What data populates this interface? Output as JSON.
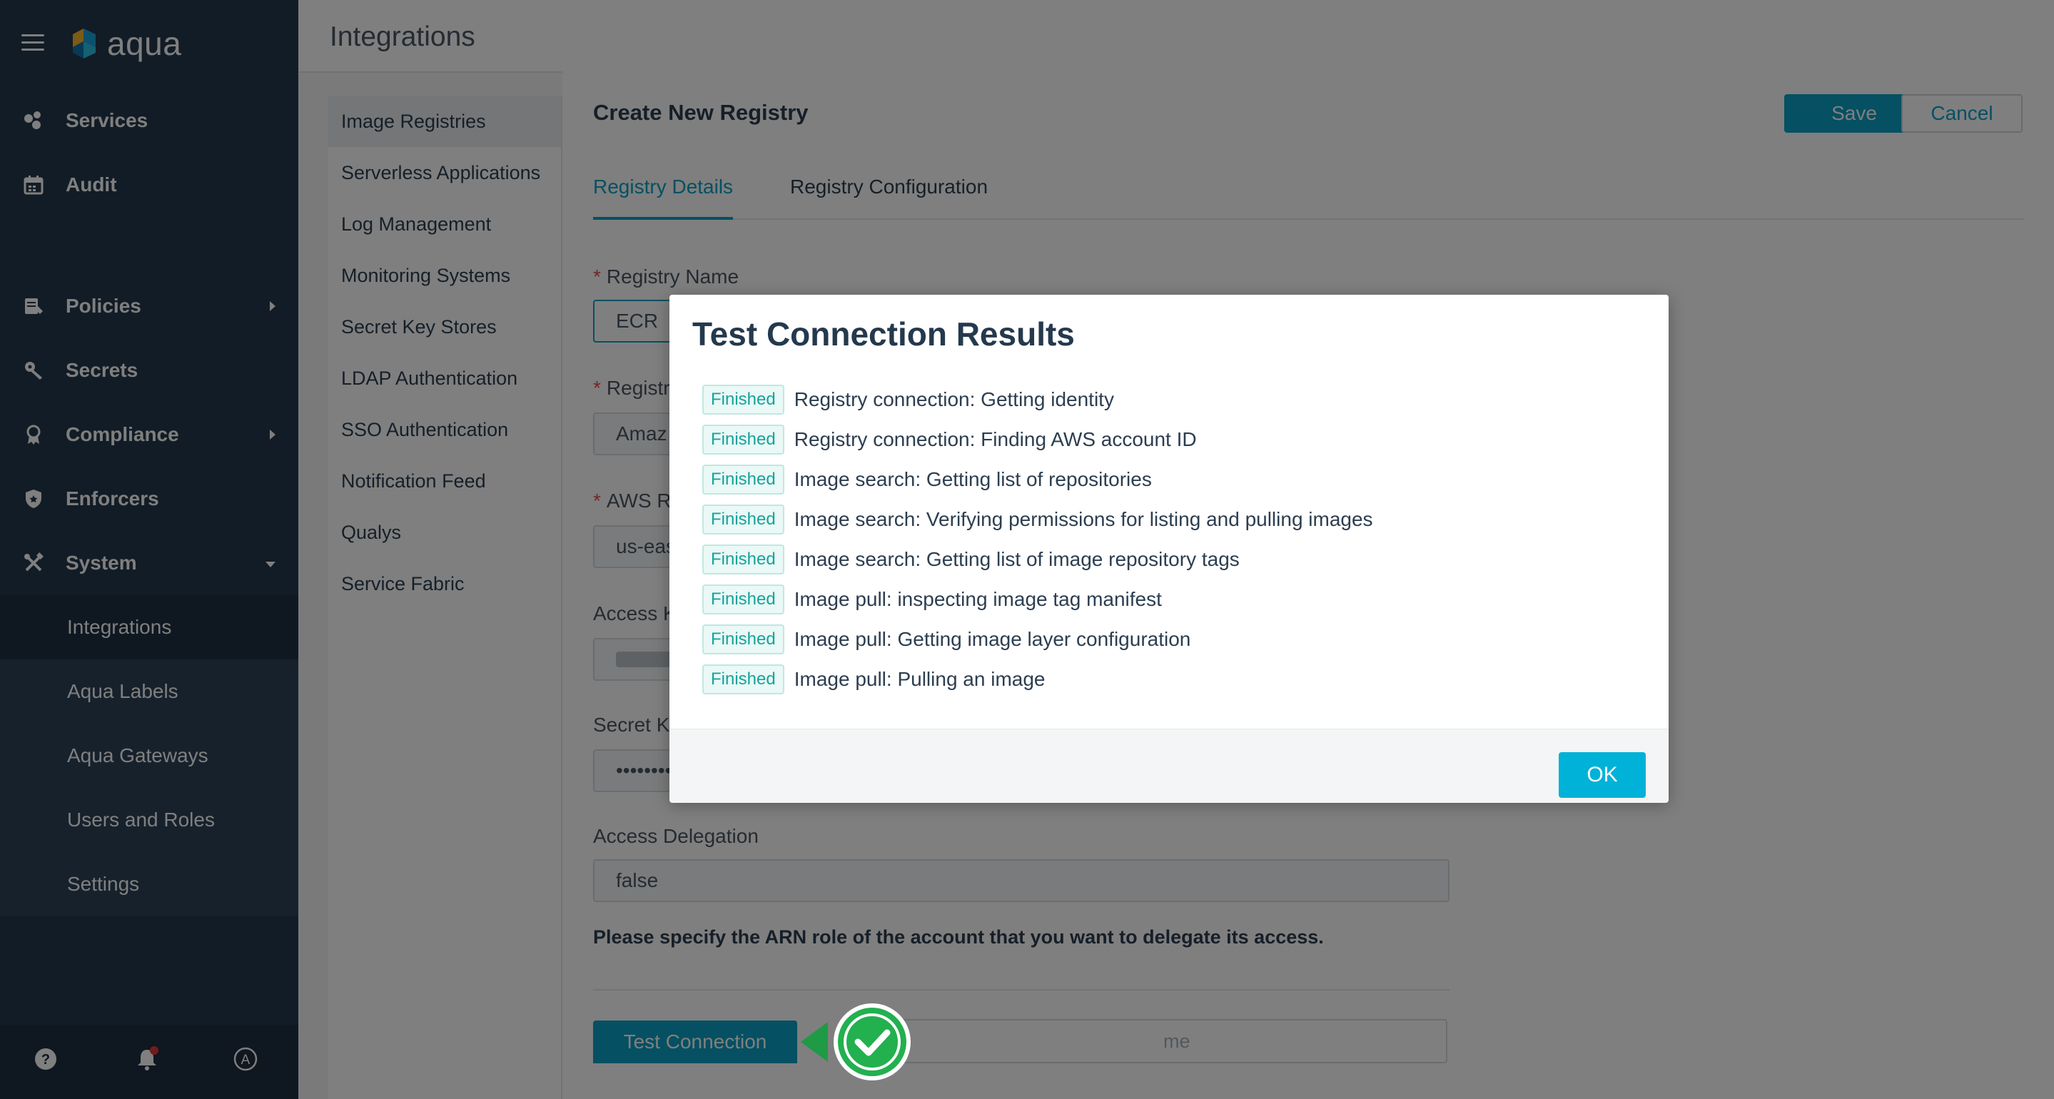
{
  "app": {
    "name": "aqua"
  },
  "sidebar": {
    "items": [
      {
        "label": "Services",
        "icon": "services-icon"
      },
      {
        "label": "Audit",
        "icon": "calendar-icon"
      },
      {
        "label": "Policies",
        "icon": "policies-icon"
      },
      {
        "label": "Secrets",
        "icon": "key-icon"
      },
      {
        "label": "Compliance",
        "icon": "ribbon-icon"
      },
      {
        "label": "Enforcers",
        "icon": "shield-icon"
      },
      {
        "label": "System",
        "icon": "tools-icon"
      }
    ],
    "system_subitems": [
      {
        "label": "Integrations"
      },
      {
        "label": "Aqua Labels"
      },
      {
        "label": "Aqua Gateways"
      },
      {
        "label": "Users and Roles"
      },
      {
        "label": "Settings"
      }
    ]
  },
  "header": {
    "title": "Integrations"
  },
  "integrations_nav": [
    "Image Registries",
    "Serverless Applications",
    "Log Management",
    "Monitoring Systems",
    "Secret Key Stores",
    "LDAP Authentication",
    "SSO Authentication",
    "Notification Feed",
    "Qualys",
    "Service Fabric"
  ],
  "form": {
    "title": "Create New Registry",
    "save_label": "Save",
    "cancel_label": "Cancel",
    "tabs": [
      "Registry Details",
      "Registry Configuration"
    ],
    "registry_name_label": "Registry Name",
    "registry_name_value": "ECR",
    "registry_type_label": "Registr",
    "registry_type_value": "Amaz",
    "aws_region_label": "AWS Re",
    "aws_region_value": "us-eas",
    "access_key_label": "Access K",
    "secret_key_label": "Secret Ke",
    "secret_key_value": "••••••••",
    "access_delegation_label": "Access Delegation",
    "access_delegation_value": "false",
    "arn_note": "Please specify the ARN role of the account that you want to delegate its access.",
    "test_connection_label": "Test Connection",
    "image_name_hint": "me"
  },
  "modal": {
    "title": "Test Connection Results",
    "status_label": "Finished",
    "results": [
      "Registry connection: Getting identity",
      "Registry connection: Finding AWS account ID",
      "Image search: Getting list of repositories",
      "Image search: Verifying permissions for listing and pulling images",
      "Image search: Getting list of image repository tags",
      "Image pull: inspecting image tag manifest",
      "Image pull: Getting image layer configuration",
      "Image pull: Pulling an image"
    ],
    "ok_label": "OK"
  },
  "colors": {
    "sidebar_bg": "#25394d",
    "accent": "#0aa0c4",
    "success": "#15a49a",
    "check_green": "#23b04f"
  }
}
